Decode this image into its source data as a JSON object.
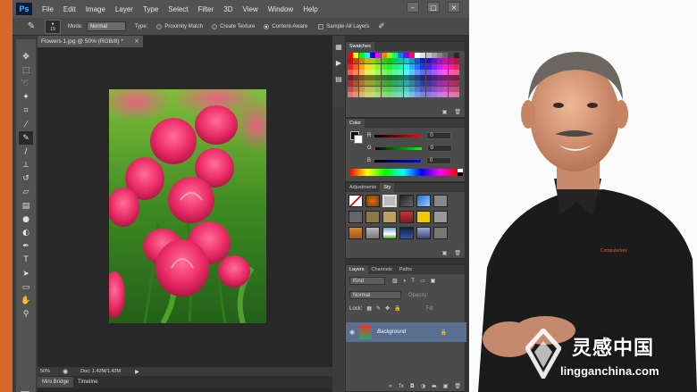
{
  "app": {
    "logo": "Ps"
  },
  "menu": [
    "File",
    "Edit",
    "Image",
    "Layer",
    "Type",
    "Select",
    "Filter",
    "3D",
    "View",
    "Window",
    "Help"
  ],
  "window_controls": [
    "–",
    "□",
    "×"
  ],
  "options_bar": {
    "brush_size": "19",
    "mode_label": "Mode:",
    "mode_value": "Normal",
    "type_label": "Type:",
    "type_options": [
      "Proximity Match",
      "Create Texture",
      "Content-Aware"
    ],
    "type_selected": "Content-Aware",
    "sample_all_layers": "Sample All Layers"
  },
  "document": {
    "tab_title": "Flowers 1.jpg @ 50% (RGB/8) *",
    "zoom": "50%",
    "doc_info": "Doc: 1.42M/1.42M"
  },
  "bottom_tabs": [
    "Mini Bridge",
    "Timeline"
  ],
  "panels": {
    "swatches": {
      "title": "Swatches"
    },
    "color": {
      "title": "Color",
      "channels": [
        {
          "label": "R",
          "value": "0"
        },
        {
          "label": "G",
          "value": "0"
        },
        {
          "label": "B",
          "value": "0"
        }
      ]
    },
    "adjustments_tab": "Adjustments",
    "styles_tab": "Sty",
    "layers": {
      "tabs": [
        "Layers",
        "Channels",
        "Paths"
      ],
      "kind_label": "Kind",
      "blend_mode": "Normal",
      "opacity_label": "Opacity:",
      "lock_label": "Lock:",
      "fill_label": "Fill:",
      "layer_name": "Background"
    }
  },
  "presenter": {
    "shirt_logo": "Computerkey"
  },
  "watermark": {
    "text": "灵感中国",
    "url": "lingganchina.com"
  },
  "colors": {
    "orange_strip": "#d6682a",
    "ps_menubar": "#535353",
    "ps_bg": "#3c3c3c"
  }
}
